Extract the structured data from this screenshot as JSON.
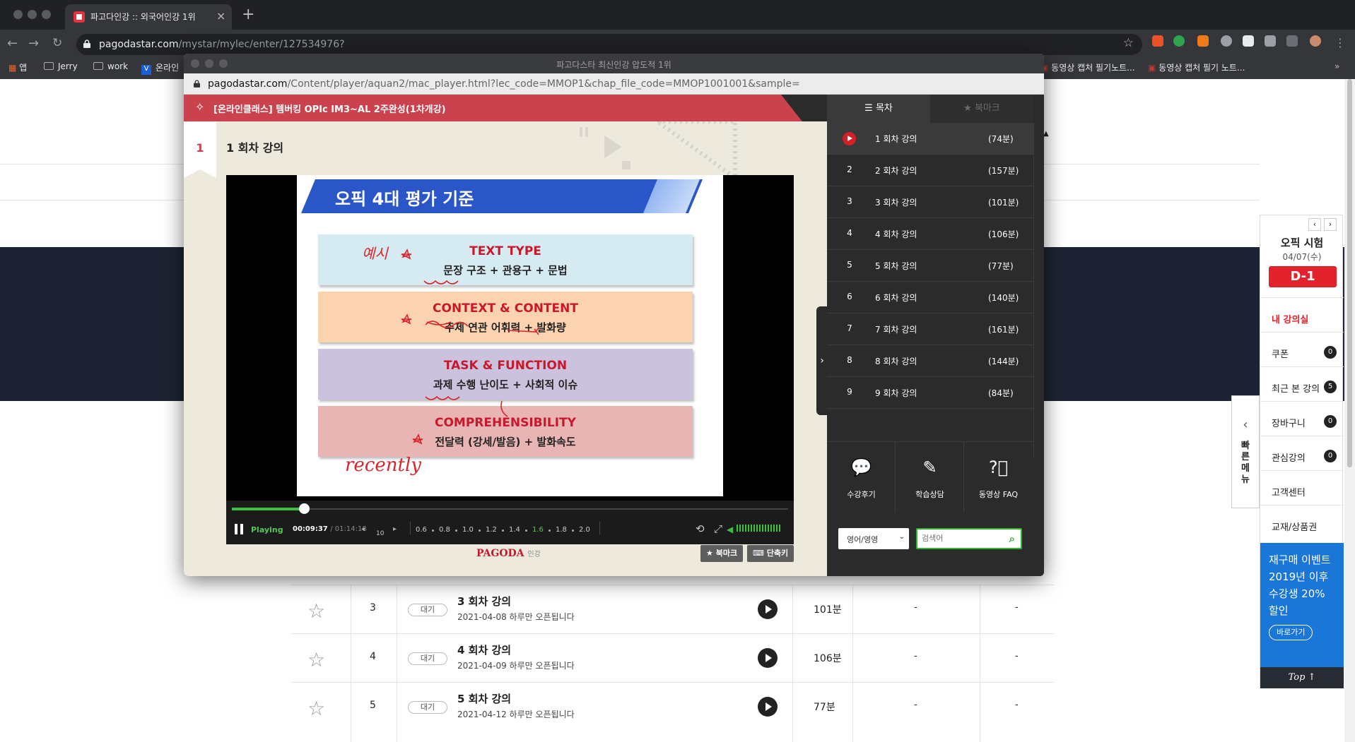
{
  "browser": {
    "tab_title": "파고다인강 :: 외국어인강 1위",
    "new_tab": "+",
    "url_host": "pagodastar.com",
    "url_path": "/mystar/mylec/enter/127534976?",
    "bookmarks": [
      "앱",
      "Jerry",
      "work",
      "온라인",
      "동영상 캡처 필기노트...",
      "동영상 캡처 필기 노트..."
    ]
  },
  "popup": {
    "window_title": "파고다스타 최신인강 압도적 1위",
    "url_host": "pagodastar.com",
    "url_path": "/Content/player/aquan2/mac_player.html?lec_code=MMOP1&chap_file_code=MMOP1001001&sample=",
    "course_title": "[온라인클래스] 템버킹 OPIc IM3~AL 2주완성(1차개강)",
    "lecture_number": "1",
    "lecture_title": "1 회차 강의"
  },
  "slide": {
    "title": "오픽 4대 평가 기준",
    "boxes": [
      {
        "heading": "TEXT TYPE",
        "sub": "문장 구조 + 관용구 + 문법",
        "color": "#d6eaf2"
      },
      {
        "heading": "CONTEXT & CONTENT",
        "sub": "주제 연관 어휘력 + 발화량",
        "color": "#fcd3b0"
      },
      {
        "heading": "TASK & FUNCTION",
        "sub": "과제 수행 난이도 + 사회적 이슈",
        "color": "#cbc3dd"
      },
      {
        "heading": "COMPREHENSIBILITY",
        "sub": "전달력 (강세/발음) + 발화속도",
        "color": "#e8b4b4"
      }
    ],
    "handwriting": [
      "예시",
      "recently"
    ]
  },
  "player": {
    "status": "Playing",
    "current_time": "00:09:37",
    "total_time": "/ 01:14:18",
    "progress": 0.13,
    "skip_seconds": "10",
    "speeds": [
      "0.6",
      "0.8",
      "1.0",
      "1.2",
      "1.4",
      "1.6",
      "1.8",
      "2.0"
    ],
    "active_speed": "1.6",
    "volume": 1.0,
    "logo": "PAGODA",
    "logo_sub": "인강",
    "bookmark_btn": "북마크",
    "shortcut_btn": "단축키"
  },
  "panel": {
    "tab_toc": "목차",
    "tab_bookmark": "북마크",
    "lectures": [
      {
        "n": "1",
        "label": "1 회차 강의",
        "min": "(74분)"
      },
      {
        "n": "2",
        "label": "2 회차 강의",
        "min": "(157분)"
      },
      {
        "n": "3",
        "label": "3 회차 강의",
        "min": "(101분)"
      },
      {
        "n": "4",
        "label": "4 회차 강의",
        "min": "(106분)"
      },
      {
        "n": "5",
        "label": "5 회차 강의",
        "min": "(77분)"
      },
      {
        "n": "6",
        "label": "6 회차 강의",
        "min": "(140분)"
      },
      {
        "n": "7",
        "label": "7 회차 강의",
        "min": "(161분)"
      },
      {
        "n": "8",
        "label": "8 회차 강의",
        "min": "(144분)"
      },
      {
        "n": "9",
        "label": "9 회차 강의",
        "min": "(84분)"
      }
    ],
    "btn_review": "수강후기",
    "btn_consult": "학습상담",
    "btn_faq": "동영상 FAQ",
    "select_value": "영어/영영",
    "search_placeholder": "검색어"
  },
  "page": {
    "rows": [
      {
        "num": "3",
        "badge": "대기",
        "title": "3 회차 강의",
        "sub": "2021-04-08 하루만 오픈됩니다",
        "min": "101분",
        "d1": "-",
        "d2": "-"
      },
      {
        "num": "4",
        "badge": "대기",
        "title": "4 회차 강의",
        "sub": "2021-04-09 하루만 오픈됩니다",
        "min": "106분",
        "d1": "-",
        "d2": "-"
      },
      {
        "num": "5",
        "badge": "대기",
        "title": "5 회차 강의",
        "sub": "2021-04-12 하루만 오픈됩니다",
        "min": "77분",
        "d1": "-",
        "d2": "-"
      }
    ],
    "sidebar": {
      "title": "오픽 시험",
      "date": "04/07(수)",
      "dday": "D-1",
      "my_class": "내 강의실",
      "items": [
        {
          "label": "쿠폰",
          "count": "0"
        },
        {
          "label": "최근 본 강의",
          "count": "5"
        },
        {
          "label": "장바구니",
          "count": "0"
        },
        {
          "label": "관심강의",
          "count": "0"
        },
        {
          "label": "고객센터",
          "count": ""
        },
        {
          "label": "교재/상품권",
          "count": ""
        }
      ],
      "promo": "재구매 이벤트 2019년 이후 수강생 20% 할인",
      "promo_btn": "바로가기",
      "top": "Top ↑"
    },
    "quick_menu": "빠른메뉴"
  }
}
